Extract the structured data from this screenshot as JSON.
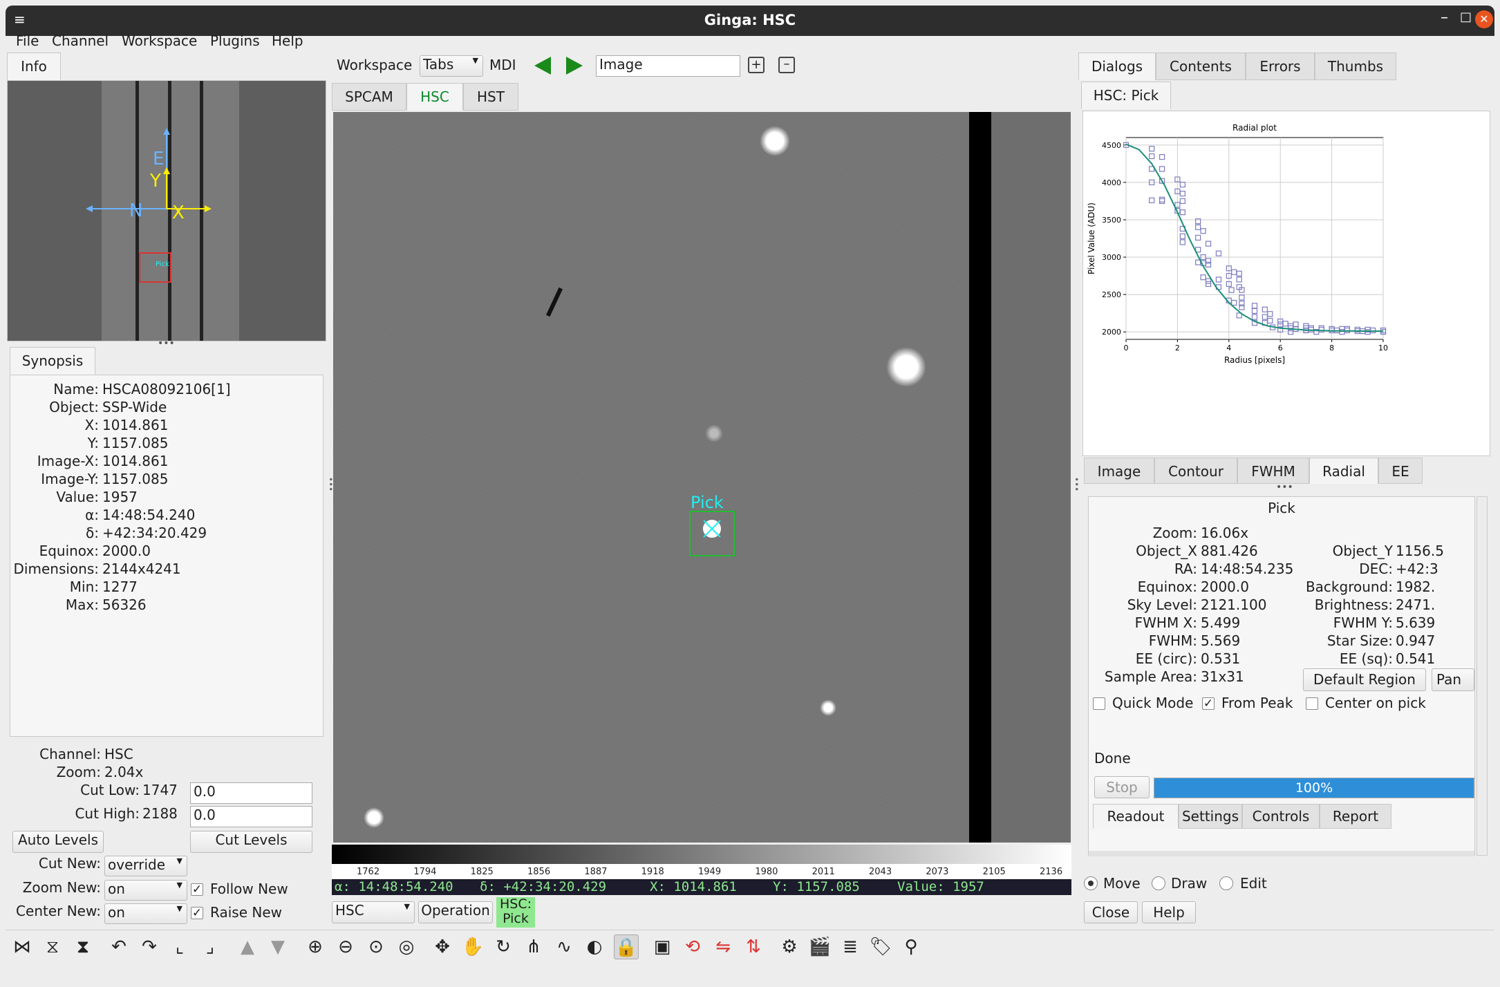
{
  "window": {
    "title": "Ginga: HSC"
  },
  "menu": [
    "File",
    "Channel",
    "Workspace",
    "Plugins",
    "Help"
  ],
  "left": {
    "tab": "Info",
    "pan_labels": {
      "E": "E",
      "N": "N",
      "X": "X",
      "Y": "Y",
      "pick": "Pick"
    },
    "synopsis_tab": "Synopsis",
    "info": [
      [
        "Name:",
        "HSCA08092106[1]"
      ],
      [
        "Object:",
        "SSP-Wide"
      ],
      [
        "X:",
        "1014.861"
      ],
      [
        "Y:",
        "1157.085"
      ],
      [
        "Image-X:",
        "1014.861"
      ],
      [
        "Image-Y:",
        "1157.085"
      ],
      [
        "Value:",
        "1957"
      ],
      [
        "α:",
        "14:48:54.240"
      ],
      [
        "δ:",
        "+42:34:20.429"
      ],
      [
        "Equinox:",
        "2000.0"
      ],
      [
        "Dimensions:",
        "2144x4241"
      ],
      [
        "Min:",
        "1277"
      ],
      [
        "Max:",
        "56326"
      ]
    ],
    "channel_label": "Channel:",
    "channel": "HSC",
    "zoom_label": "Zoom:",
    "zoom": "2.04x",
    "cut_low_label": "Cut Low:",
    "cut_low": "1747",
    "cut_low_input": "0.0",
    "cut_high_label": "Cut High:",
    "cut_high": "2188",
    "cut_high_input": "0.0",
    "auto_levels": "Auto Levels",
    "cut_levels": "Cut Levels",
    "cut_new_label": "Cut New:",
    "cut_new": "override",
    "zoom_new_label": "Zoom New:",
    "zoom_new": "on",
    "follow_new": "Follow New",
    "center_new_label": "Center New:",
    "center_new": "on",
    "raise_new": "Raise New"
  },
  "center": {
    "workspace_label": "Workspace",
    "workspace_mode": "Tabs",
    "mdi": "MDI",
    "image_input": "Image",
    "tabs": [
      "SPCAM",
      "HSC",
      "HST"
    ],
    "pick_label": "Pick",
    "colorbar_ticks": [
      "1762",
      "1794",
      "1825",
      "1856",
      "1887",
      "1918",
      "1949",
      "1980",
      "2011",
      "2043",
      "2073",
      "2105",
      "2136"
    ],
    "readout": {
      "ra": "α: 14:48:54.240",
      "dec": "δ: +42:34:20.429",
      "x": "X: 1014.861",
      "y": "Y: 1157.085",
      "value": "Value: 1957"
    },
    "channel_select": "HSC",
    "operation": "Operation",
    "mode_badge_1": "HSC:",
    "mode_badge_2": "Pick"
  },
  "right": {
    "tabs": [
      "Dialogs",
      "Contents",
      "Errors",
      "Thumbs"
    ],
    "sub_tab": "HSC: Pick",
    "plot_tabs": [
      "Image",
      "Contour",
      "FWHM",
      "Radial",
      "EE"
    ],
    "pick_title": "Pick",
    "left_stats": [
      [
        "Zoom:",
        "16.06x"
      ],
      [
        "Object_X",
        "881.426"
      ],
      [
        "RA:",
        "14:48:54.235"
      ],
      [
        "Equinox:",
        "2000.0"
      ],
      [
        "Sky Level:",
        "2121.100"
      ],
      [
        "FWHM X:",
        "5.499"
      ],
      [
        "FWHM:",
        "5.569"
      ],
      [
        "EE (circ):",
        "0.531"
      ],
      [
        "Sample Area:",
        "31x31"
      ]
    ],
    "right_stats": [
      [
        "Object_Y",
        "1156.5"
      ],
      [
        "DEC:",
        "+42:3"
      ],
      [
        "Background:",
        "1982."
      ],
      [
        "Brightness:",
        "2471."
      ],
      [
        "FWHM Y:",
        "5.639"
      ],
      [
        "Star Size:",
        "0.947"
      ],
      [
        "EE (sq):",
        "0.541"
      ]
    ],
    "default_region": "Default Region",
    "pan": "Pan",
    "quick_mode": "Quick Mode",
    "from_peak": "From Peak",
    "center_on_pick": "Center on pick",
    "status": "Done",
    "stop": "Stop",
    "progress_text": "100%",
    "progress": 1.0,
    "bottom_tabs": [
      "Readout",
      "Settings",
      "Controls",
      "Report"
    ],
    "modes": [
      "Move",
      "Draw",
      "Edit"
    ],
    "close": "Close",
    "help": "Help"
  },
  "chart_data": {
    "type": "scatter",
    "title": "Radial plot",
    "xlabel": "Radius [pixels]",
    "ylabel": "Pixel Value (ADU)",
    "xlim": [
      0,
      10
    ],
    "ylim": [
      1900,
      4600
    ],
    "xticks": [
      0,
      2,
      4,
      6,
      8,
      10
    ],
    "yticks": [
      2000,
      2500,
      3000,
      3500,
      4000,
      4500
    ],
    "series": [
      {
        "kind": "points",
        "color": "#7b7bc0",
        "points": [
          [
            0,
            4500
          ],
          [
            1,
            4450
          ],
          [
            1,
            4350
          ],
          [
            1.4,
            4340
          ],
          [
            1,
            4180
          ],
          [
            1.4,
            4180
          ],
          [
            1,
            4000
          ],
          [
            1.4,
            4020
          ],
          [
            1,
            3760
          ],
          [
            1.4,
            3750
          ],
          [
            1.4,
            3770
          ],
          [
            2,
            4040
          ],
          [
            2.2,
            3970
          ],
          [
            2,
            3880
          ],
          [
            2.2,
            3850
          ],
          [
            2,
            3700
          ],
          [
            2.2,
            3750
          ],
          [
            2,
            3620
          ],
          [
            2.2,
            3600
          ],
          [
            2.2,
            3380
          ],
          [
            2.8,
            3480
          ],
          [
            2.8,
            3400
          ],
          [
            2.2,
            3280
          ],
          [
            2.2,
            3200
          ],
          [
            2.8,
            3260
          ],
          [
            3,
            3350
          ],
          [
            3.2,
            3180
          ],
          [
            2.8,
            3100
          ],
          [
            3,
            3000
          ],
          [
            3.2,
            2950
          ],
          [
            3.6,
            3050
          ],
          [
            2.8,
            2930
          ],
          [
            3,
            2920
          ],
          [
            3.2,
            2900
          ],
          [
            3.2,
            2680
          ],
          [
            3.6,
            2700
          ],
          [
            3.6,
            2600
          ],
          [
            3,
            2730
          ],
          [
            3.2,
            2640
          ],
          [
            4,
            2850
          ],
          [
            4,
            2750
          ],
          [
            4.2,
            2800
          ],
          [
            4,
            2640
          ],
          [
            4.4,
            2780
          ],
          [
            4.4,
            2700
          ],
          [
            4.4,
            2600
          ],
          [
            4.1,
            2560
          ],
          [
            4.5,
            2560
          ],
          [
            4,
            2420
          ],
          [
            4.2,
            2390
          ],
          [
            4.5,
            2460
          ],
          [
            4.5,
            2380
          ],
          [
            4.5,
            2330
          ],
          [
            4.4,
            2220
          ],
          [
            5,
            2350
          ],
          [
            5,
            2200
          ],
          [
            5,
            2280
          ],
          [
            5,
            2120
          ],
          [
            5.4,
            2200
          ],
          [
            5.4,
            2300
          ],
          [
            5.4,
            2120
          ],
          [
            5.6,
            2240
          ],
          [
            5.6,
            2150
          ],
          [
            5.7,
            2060
          ],
          [
            6,
            2140
          ],
          [
            6,
            2100
          ],
          [
            6,
            2030
          ],
          [
            6.2,
            2110
          ],
          [
            6.4,
            2080
          ],
          [
            6.4,
            2050
          ],
          [
            6.6,
            2040
          ],
          [
            6.6,
            2100
          ],
          [
            6.4,
            2000
          ],
          [
            7,
            2050
          ],
          [
            7,
            2020
          ],
          [
            7,
            2080
          ],
          [
            7.2,
            2050
          ],
          [
            7.2,
            2030
          ],
          [
            7.4,
            2000
          ],
          [
            7.6,
            2030
          ],
          [
            7.6,
            2050
          ],
          [
            8,
            2020
          ],
          [
            8,
            2040
          ],
          [
            8.2,
            2020
          ],
          [
            8.4,
            2040
          ],
          [
            8.4,
            2000
          ],
          [
            8.6,
            2040
          ],
          [
            8.6,
            2020
          ],
          [
            9,
            2010
          ],
          [
            9,
            2030
          ],
          [
            9.2,
            2010
          ],
          [
            9.4,
            2030
          ],
          [
            9.4,
            2000
          ],
          [
            9.6,
            2020
          ],
          [
            10,
            2000
          ],
          [
            10,
            2020
          ]
        ]
      },
      {
        "kind": "fit",
        "color": "#1a8f78",
        "points": [
          [
            0,
            4510
          ],
          [
            0.5,
            4440
          ],
          [
            1,
            4250
          ],
          [
            1.5,
            3960
          ],
          [
            2,
            3600
          ],
          [
            2.5,
            3220
          ],
          [
            3,
            2880
          ],
          [
            3.5,
            2600
          ],
          [
            4,
            2390
          ],
          [
            4.5,
            2240
          ],
          [
            5,
            2140
          ],
          [
            5.5,
            2080
          ],
          [
            6,
            2050
          ],
          [
            7,
            2025
          ],
          [
            8,
            2015
          ],
          [
            9,
            2012
          ],
          [
            10,
            2010
          ]
        ]
      }
    ]
  },
  "toolbar": {
    "icons": [
      "ruler-icon",
      "hourglass-icon",
      "hourglass-alt-icon",
      "undo-icon",
      "redo-icon",
      "axis-icon",
      "axis-alt-icon",
      "arrow-up-icon",
      "arrow-down-icon",
      "zoom-in-icon",
      "zoom-out-icon",
      "zoom-fit-icon",
      "zoom-100-icon",
      "pan-icon",
      "hand-icon",
      "rotate-icon",
      "distribute-icon",
      "curve-icon",
      "contrast-icon",
      "lock-icon",
      "image-icon",
      "rotate-red-icon",
      "flip-x-icon",
      "flip-y-icon",
      "settings-icon",
      "clapboard-icon",
      "layers-icon",
      "tags-icon",
      "microscope-icon"
    ]
  }
}
